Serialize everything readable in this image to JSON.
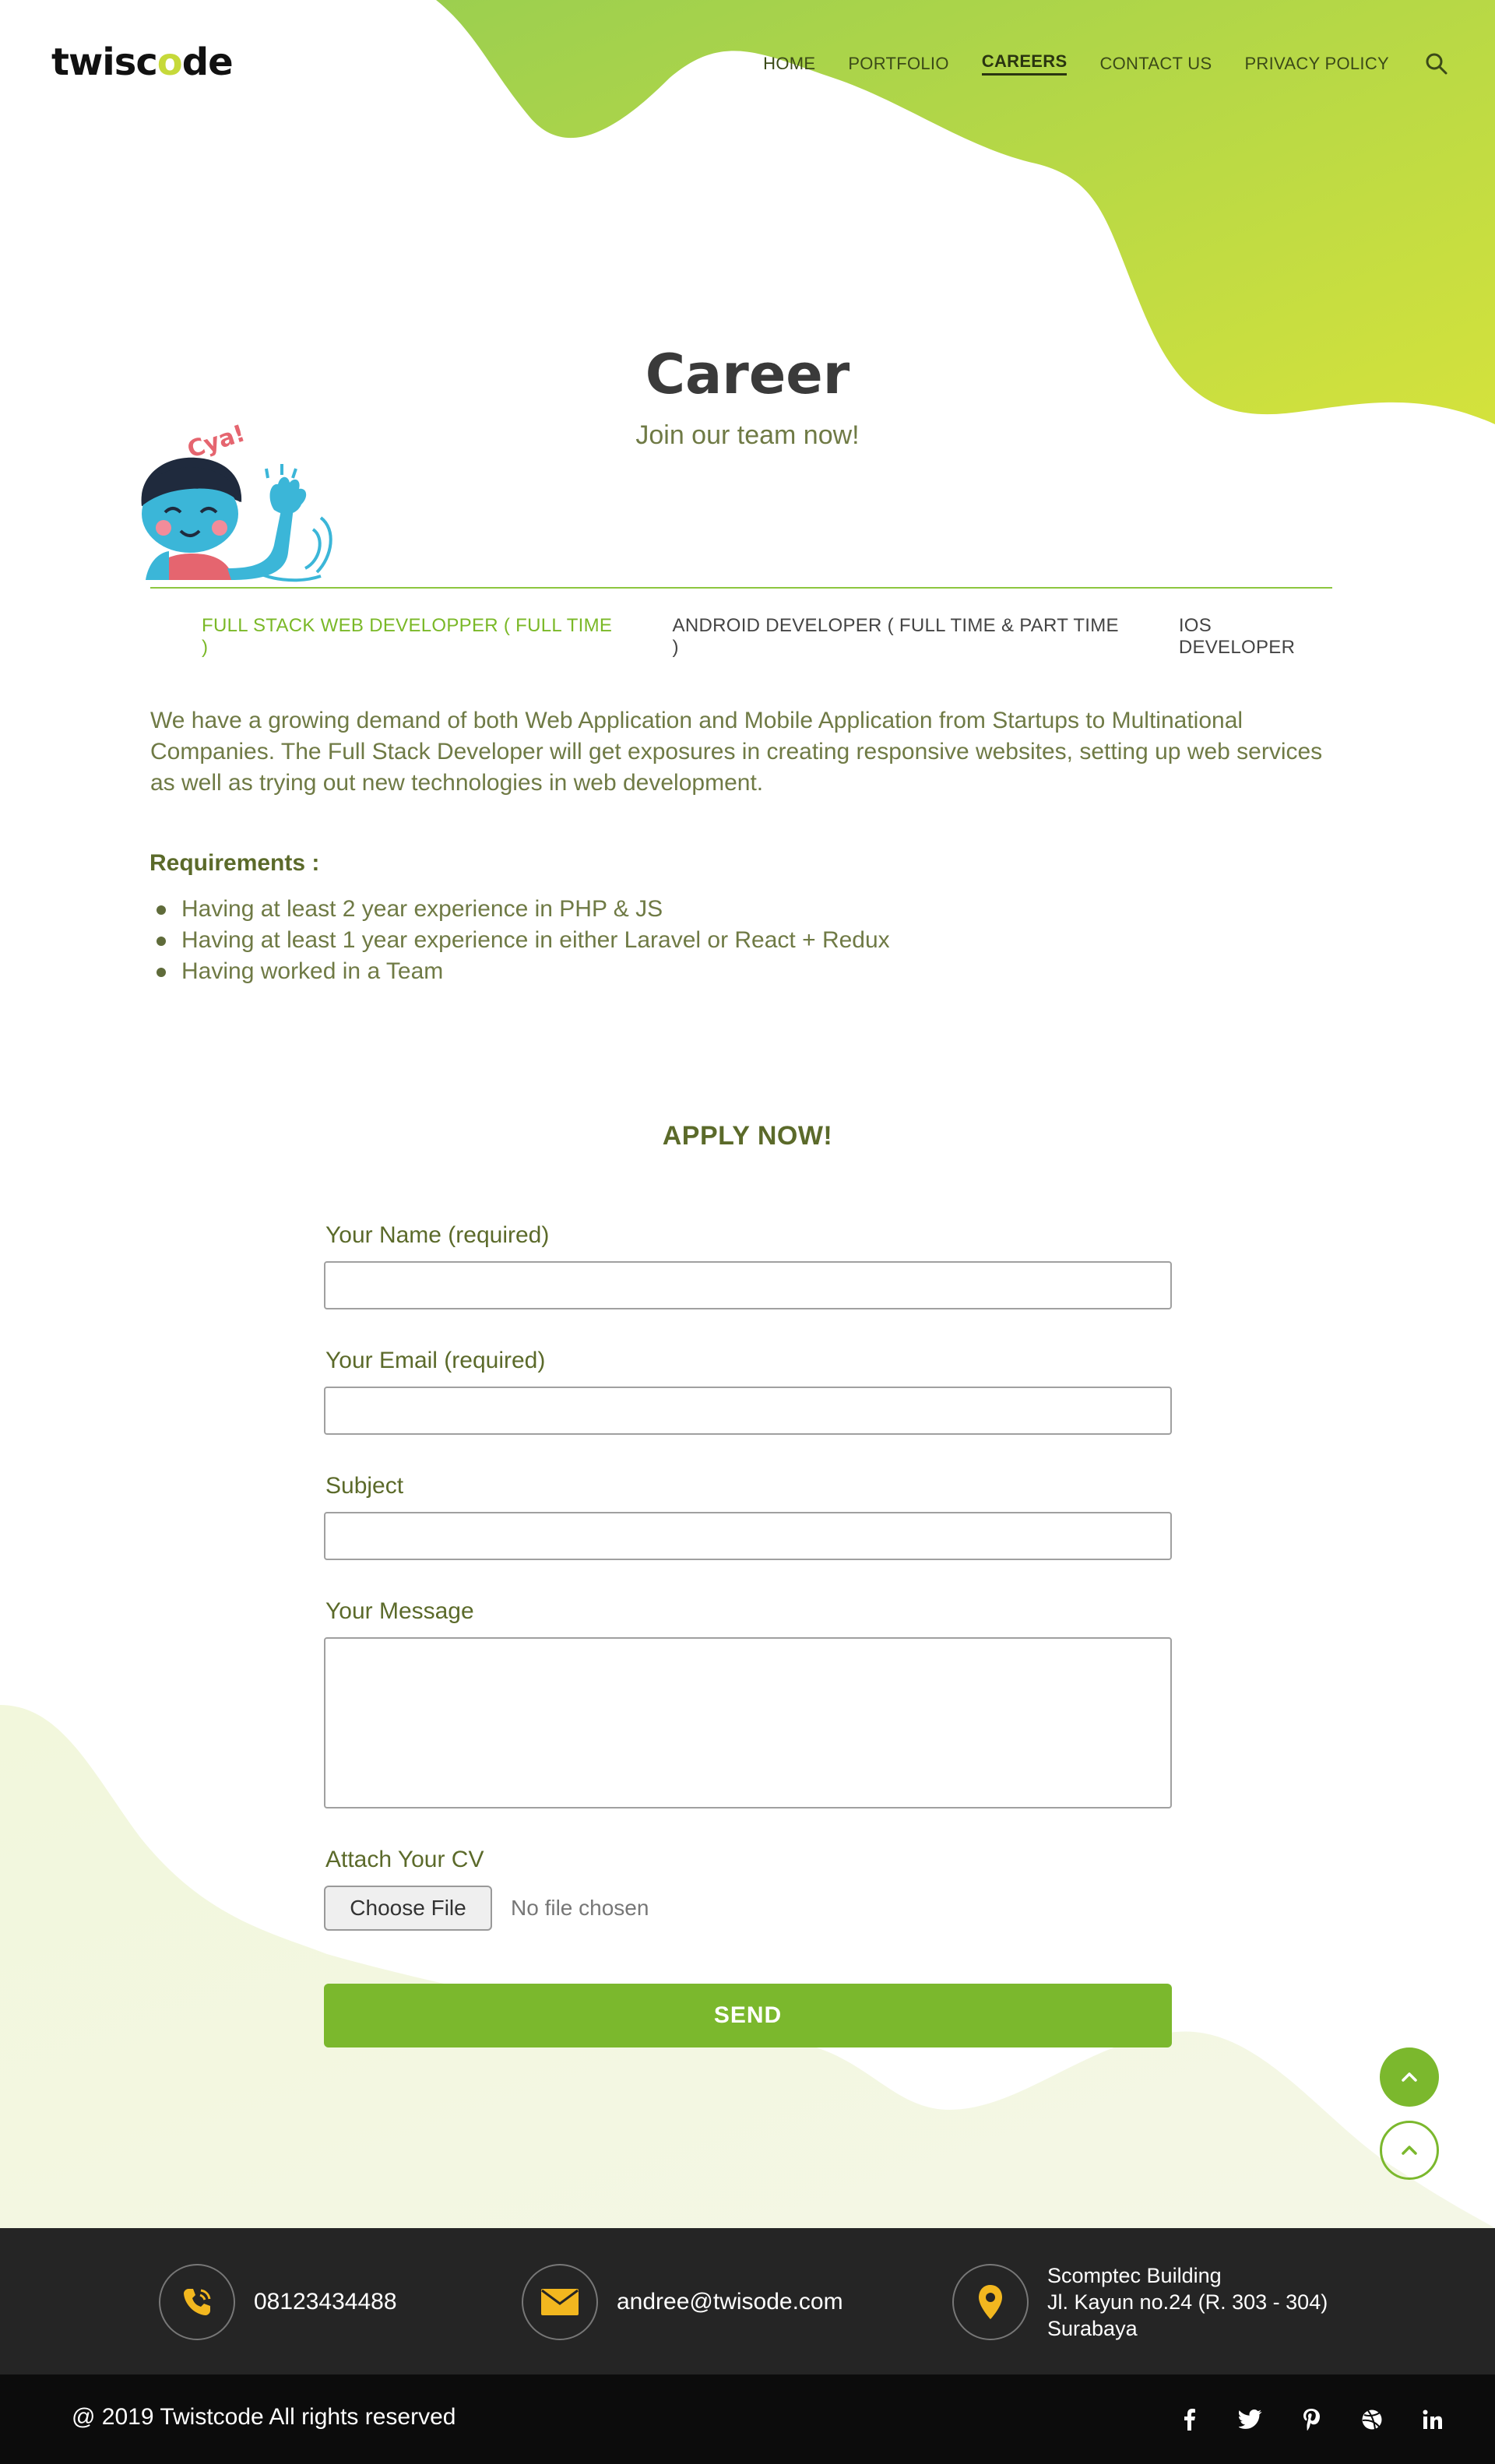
{
  "brand": {
    "logo_prefix": "twisc",
    "logo_o": "o",
    "logo_suffix": "de"
  },
  "nav": {
    "items": [
      "HOME",
      "PORTFOLIO",
      "CAREERS",
      "CONTACT US",
      "PRIVACY POLICY"
    ],
    "active": "CAREERS",
    "search_icon": "search-icon"
  },
  "hero": {
    "title": "Career",
    "subtitle": "Join our team now!",
    "mascot_text": "Cya!"
  },
  "tabs": [
    {
      "label": "FULL STACK WEB DEVELOPPER ( FULL TIME )",
      "active": true
    },
    {
      "label": "ANDROID DEVELOPER ( FULL TIME & PART TIME )",
      "active": false
    },
    {
      "label": "IOS DEVELOPER",
      "active": false
    }
  ],
  "job": {
    "description": "We have a growing demand of both Web Application and Mobile Application from Startups to Multinational Companies. The Full Stack Developer will get exposures in creating responsive websites, setting up web services as well as trying out new technologies in web development.",
    "requirements_title": "Requirements :",
    "requirements": [
      "Having at least 2 year experience in PHP & JS",
      "Having at least 1 year experience in either Laravel or React + Redux",
      "Having worked in a Team"
    ]
  },
  "form": {
    "heading": "APPLY NOW!",
    "name_label": "Your Name (required)",
    "name_value": "",
    "email_label": "Your Email (required)",
    "email_value": "",
    "subject_label": "Subject",
    "subject_value": "",
    "message_label": "Your Message",
    "message_value": "",
    "cv_label": "Attach Your CV",
    "file_button": "Choose File",
    "file_status": "No file chosen",
    "send_label": "SEND"
  },
  "contact": {
    "phone": "08123434488",
    "email": "andree@twisode.com",
    "address_line1": "Scomptec Building",
    "address_line2": "Jl. Kayun no.24 (R. 303 - 304)",
    "address_line3": "Surabaya"
  },
  "footer": {
    "copyright": "@ 2019 Twistcode All rights reserved",
    "socials": [
      "facebook-icon",
      "twitter-icon",
      "pinterest-icon",
      "dribbble-icon",
      "linkedin-icon"
    ]
  },
  "colors": {
    "accent": "#7bb82d",
    "blob_start": "#9ccf4f",
    "blob_end": "#d4e23c",
    "footer_dark": "#252525",
    "footer_black": "#0c0c0c",
    "contact_icon": "#f2b71f"
  }
}
